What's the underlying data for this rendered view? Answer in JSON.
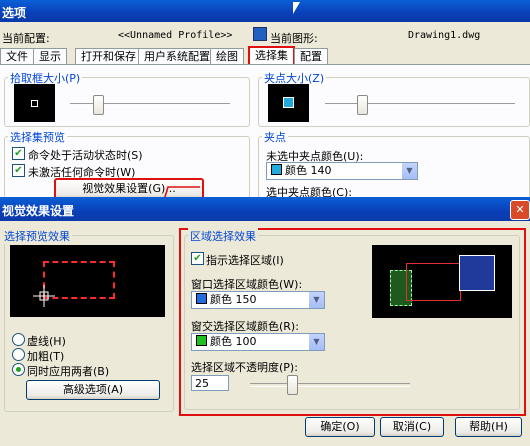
{
  "options": {
    "title": "选项",
    "current_config_label": "当前配置:",
    "current_config_value": "<<Unnamed Profile>>",
    "current_drawing_label": "当前图形:",
    "current_drawing_value": "Drawing1.dwg",
    "tabs": [
      "文件",
      "显示",
      "打开和保存",
      "用户系统配置",
      "绘图",
      "选择集",
      "配置"
    ],
    "pickbox_title": "拾取框大小(P)",
    "grip_size_title": "夹点大小(Z)",
    "preview_title": "选择集预览",
    "cb_active": "命令处于活动状态时(S)",
    "cb_inactive": "未激活任何命令时(W)",
    "visual_btn": "视觉效果设置(G)...",
    "grips_title": "夹点",
    "unselected_grip_color": "未选中夹点颜色(U):",
    "unselected_grip_value": "颜色 140",
    "selected_grip_color": "选中夹点颜色(C):"
  },
  "visual": {
    "title": "视觉效果设置",
    "preview_title": "选择预览效果",
    "radio_dashed": "虚线(H)",
    "radio_thick": "加粗(T)",
    "radio_both": "同时应用两者(B)",
    "advanced_btn": "高级选项(A)",
    "area_title": "区域选择效果",
    "cb_indicate": "指示选择区域(I)",
    "window_color_label": "窗口选择区域颜色(W):",
    "window_color_value": "颜色 150",
    "crossing_color_label": "窗交选择区域颜色(R):",
    "crossing_color_value": "颜色 100",
    "opacity_label": "选择区域不透明度(P):",
    "opacity_value": "25",
    "ok": "确定(O)",
    "cancel": "取消(C)",
    "help": "帮助(H)"
  },
  "colors": {
    "window_swatch": "#1f6fe0",
    "crossing_swatch": "#20c020",
    "grip": "#22aadd",
    "highlight": "#e01010"
  }
}
